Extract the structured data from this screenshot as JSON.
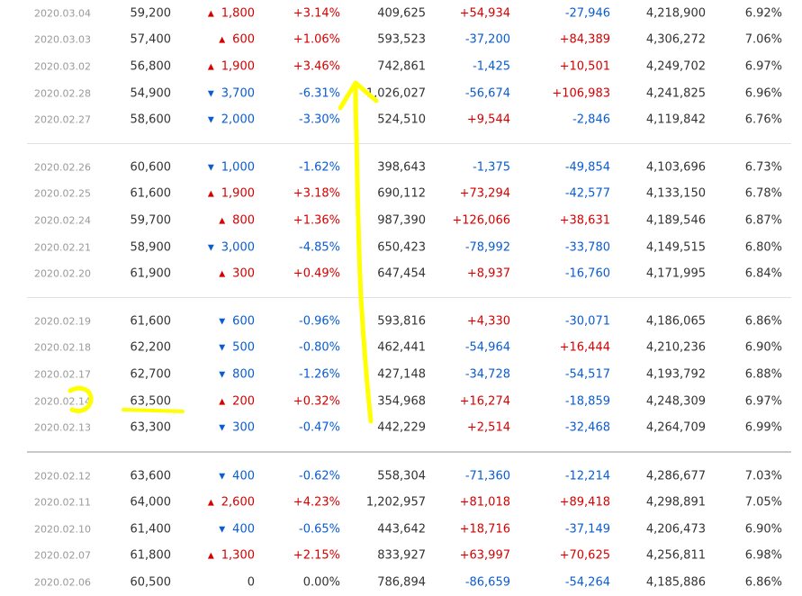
{
  "groups": [
    {
      "rows": [
        {
          "date": "2020.03.04",
          "close": "59,200",
          "dir": "up",
          "arrow": "▲",
          "change": "1,800",
          "rate": "+3.14%",
          "volume": "409,625",
          "institution": "+54,934",
          "inst_dir": "up",
          "foreign": "-27,946",
          "for_dir": "down",
          "holdings": "4,218,900",
          "ratio": "6.92%"
        },
        {
          "date": "2020.03.03",
          "close": "57,400",
          "dir": "up",
          "arrow": "▲",
          "change": "600",
          "rate": "+1.06%",
          "volume": "593,523",
          "institution": "-37,200",
          "inst_dir": "down",
          "foreign": "+84,389",
          "for_dir": "up",
          "holdings": "4,306,272",
          "ratio": "7.06%"
        },
        {
          "date": "2020.03.02",
          "close": "56,800",
          "dir": "up",
          "arrow": "▲",
          "change": "1,900",
          "rate": "+3.46%",
          "volume": "742,861",
          "institution": "-1,425",
          "inst_dir": "down",
          "foreign": "+10,501",
          "for_dir": "up",
          "holdings": "4,249,702",
          "ratio": "6.97%"
        },
        {
          "date": "2020.02.28",
          "close": "54,900",
          "dir": "down",
          "arrow": "▼",
          "change": "3,700",
          "rate": "-6.31%",
          "volume": "1,026,027",
          "institution": "-56,674",
          "inst_dir": "down",
          "foreign": "+106,983",
          "for_dir": "up",
          "holdings": "4,241,825",
          "ratio": "6.96%"
        },
        {
          "date": "2020.02.27",
          "close": "58,600",
          "dir": "down",
          "arrow": "▼",
          "change": "2,000",
          "rate": "-3.30%",
          "volume": "524,510",
          "institution": "+9,544",
          "inst_dir": "up",
          "foreign": "-2,846",
          "for_dir": "down",
          "holdings": "4,119,842",
          "ratio": "6.76%"
        }
      ]
    },
    {
      "rows": [
        {
          "date": "2020.02.26",
          "close": "60,600",
          "dir": "down",
          "arrow": "▼",
          "change": "1,000",
          "rate": "-1.62%",
          "volume": "398,643",
          "institution": "-1,375",
          "inst_dir": "down",
          "foreign": "-49,854",
          "for_dir": "down",
          "holdings": "4,103,696",
          "ratio": "6.73%"
        },
        {
          "date": "2020.02.25",
          "close": "61,600",
          "dir": "up",
          "arrow": "▲",
          "change": "1,900",
          "rate": "+3.18%",
          "volume": "690,112",
          "institution": "+73,294",
          "inst_dir": "up",
          "foreign": "-42,577",
          "for_dir": "down",
          "holdings": "4,133,150",
          "ratio": "6.78%"
        },
        {
          "date": "2020.02.24",
          "close": "59,700",
          "dir": "up",
          "arrow": "▲",
          "change": "800",
          "rate": "+1.36%",
          "volume": "987,390",
          "institution": "+126,066",
          "inst_dir": "up",
          "foreign": "+38,631",
          "for_dir": "up",
          "holdings": "4,189,546",
          "ratio": "6.87%"
        },
        {
          "date": "2020.02.21",
          "close": "58,900",
          "dir": "down",
          "arrow": "▼",
          "change": "3,000",
          "rate": "-4.85%",
          "volume": "650,423",
          "institution": "-78,992",
          "inst_dir": "down",
          "foreign": "-33,780",
          "for_dir": "down",
          "holdings": "4,149,515",
          "ratio": "6.80%"
        },
        {
          "date": "2020.02.20",
          "close": "61,900",
          "dir": "up",
          "arrow": "▲",
          "change": "300",
          "rate": "+0.49%",
          "volume": "647,454",
          "institution": "+8,937",
          "inst_dir": "up",
          "foreign": "-16,760",
          "for_dir": "down",
          "holdings": "4,171,995",
          "ratio": "6.84%"
        }
      ]
    },
    {
      "rows": [
        {
          "date": "2020.02.19",
          "close": "61,600",
          "dir": "down",
          "arrow": "▼",
          "change": "600",
          "rate": "-0.96%",
          "volume": "593,816",
          "institution": "+4,330",
          "inst_dir": "up",
          "foreign": "-30,071",
          "for_dir": "down",
          "holdings": "4,186,065",
          "ratio": "6.86%"
        },
        {
          "date": "2020.02.18",
          "close": "62,200",
          "dir": "down",
          "arrow": "▼",
          "change": "500",
          "rate": "-0.80%",
          "volume": "462,441",
          "institution": "-54,964",
          "inst_dir": "down",
          "foreign": "+16,444",
          "for_dir": "up",
          "holdings": "4,210,236",
          "ratio": "6.90%"
        },
        {
          "date": "2020.02.17",
          "close": "62,700",
          "dir": "down",
          "arrow": "▼",
          "change": "800",
          "rate": "-1.26%",
          "volume": "427,148",
          "institution": "-34,728",
          "inst_dir": "down",
          "foreign": "-54,517",
          "for_dir": "down",
          "holdings": "4,193,792",
          "ratio": "6.88%"
        },
        {
          "date": "2020.02.14",
          "close": "63,500",
          "dir": "up",
          "arrow": "▲",
          "change": "200",
          "rate": "+0.32%",
          "volume": "354,968",
          "institution": "+16,274",
          "inst_dir": "up",
          "foreign": "-18,859",
          "for_dir": "down",
          "holdings": "4,248,309",
          "ratio": "6.97%"
        },
        {
          "date": "2020.02.13",
          "close": "63,300",
          "dir": "down",
          "arrow": "▼",
          "change": "300",
          "rate": "-0.47%",
          "volume": "442,229",
          "institution": "+2,514",
          "inst_dir": "up",
          "foreign": "-32,468",
          "for_dir": "down",
          "holdings": "4,264,709",
          "ratio": "6.99%"
        }
      ]
    },
    {
      "rows": [
        {
          "date": "2020.02.12",
          "close": "63,600",
          "dir": "down",
          "arrow": "▼",
          "change": "400",
          "rate": "-0.62%",
          "volume": "558,304",
          "institution": "-71,360",
          "inst_dir": "down",
          "foreign": "-12,214",
          "for_dir": "down",
          "holdings": "4,286,677",
          "ratio": "7.03%"
        },
        {
          "date": "2020.02.11",
          "close": "64,000",
          "dir": "up",
          "arrow": "▲",
          "change": "2,600",
          "rate": "+4.23%",
          "volume": "1,202,957",
          "institution": "+81,018",
          "inst_dir": "up",
          "foreign": "+89,418",
          "for_dir": "up",
          "holdings": "4,298,891",
          "ratio": "7.05%"
        },
        {
          "date": "2020.02.10",
          "close": "61,400",
          "dir": "down",
          "arrow": "▼",
          "change": "400",
          "rate": "-0.65%",
          "volume": "443,642",
          "institution": "+18,716",
          "inst_dir": "up",
          "foreign": "-37,149",
          "for_dir": "down",
          "holdings": "4,206,473",
          "ratio": "6.90%"
        },
        {
          "date": "2020.02.07",
          "close": "61,800",
          "dir": "up",
          "arrow": "▲",
          "change": "1,300",
          "rate": "+2.15%",
          "volume": "833,927",
          "institution": "+63,997",
          "inst_dir": "up",
          "foreign": "+70,625",
          "for_dir": "up",
          "holdings": "4,256,811",
          "ratio": "6.98%"
        },
        {
          "date": "2020.02.06",
          "close": "60,500",
          "dir": "flat",
          "arrow": "",
          "change": "0",
          "rate": "0.00%",
          "volume": "786,894",
          "institution": "-86,659",
          "inst_dir": "down",
          "foreign": "-54,264",
          "for_dir": "down",
          "holdings": "4,185,886",
          "ratio": "6.86%"
        }
      ]
    }
  ],
  "colors": {
    "up": "#d60000",
    "down": "#0a5cd1",
    "neutral": "#333333",
    "date": "#999999",
    "annotation": "#ffff00"
  }
}
